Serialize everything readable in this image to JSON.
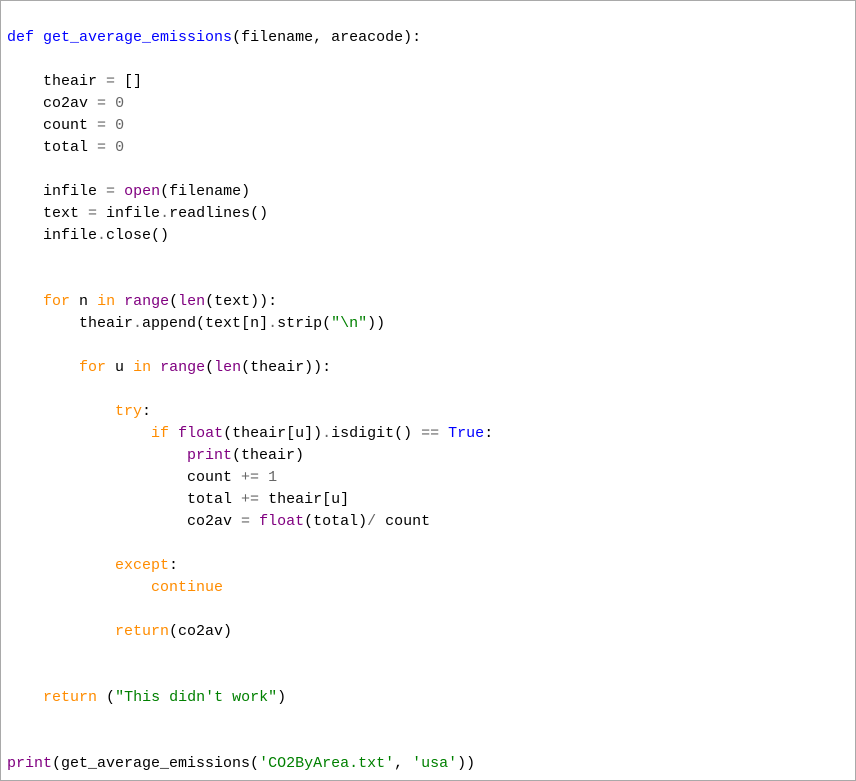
{
  "code": {
    "l1": {
      "def": "def",
      "fn": "get_average_emissions",
      "params": "(filename, areacode)",
      "colon": ":"
    },
    "l2": "",
    "l3": {
      "indent": "    ",
      "text1": "theair ",
      "op": "=",
      "text2": " []"
    },
    "l4": {
      "indent": "    ",
      "text1": "co2av ",
      "op": "=",
      "text2": " ",
      "num": "0"
    },
    "l5": {
      "indent": "    ",
      "text1": "count ",
      "op": "=",
      "text2": " ",
      "num": "0"
    },
    "l6": {
      "indent": "    ",
      "text1": "total ",
      "op": "=",
      "text2": " ",
      "num": "0"
    },
    "l7": "",
    "l8": {
      "indent": "    ",
      "text1": "infile ",
      "op": "=",
      "sp": " ",
      "builtin": "open",
      "text2": "(filename)"
    },
    "l9": {
      "indent": "    ",
      "text1": "text ",
      "op": "=",
      "text2": " infile",
      "dot": ".",
      "text3": "readlines()"
    },
    "l10": {
      "indent": "    ",
      "text1": "infile",
      "dot": ".",
      "text2": "close()"
    },
    "l11": "",
    "l12": "",
    "l13": {
      "indent": "    ",
      "for": "for",
      "sp1": " ",
      "var": "n",
      "sp2": " ",
      "in": "in",
      "sp3": " ",
      "range": "range",
      "lp": "(",
      "len": "len",
      "text": "(text))",
      "colon": ":"
    },
    "l14": {
      "indent": "        ",
      "text1": "theair",
      "dot": ".",
      "text2": "append(text[n]",
      "dot2": ".",
      "text3": "strip(",
      "str": "\"\\n\"",
      "text4": "))"
    },
    "l15": "",
    "l16": {
      "indent": "        ",
      "for": "for",
      "sp1": " ",
      "var": "u",
      "sp2": " ",
      "in": "in",
      "sp3": " ",
      "range": "range",
      "lp": "(",
      "len": "len",
      "text": "(theair))",
      "colon": ":"
    },
    "l17": "",
    "l18": {
      "indent": "            ",
      "try": "try",
      "colon": ":"
    },
    "l19": {
      "indent": "                ",
      "if": "if",
      "sp": " ",
      "float": "float",
      "text1": "(theair[u])",
      "dot": ".",
      "text2": "isdigit() ",
      "op": "==",
      "sp2": " ",
      "true": "True",
      "colon": ":"
    },
    "l20": {
      "indent": "                    ",
      "print": "print",
      "text": "(theair)"
    },
    "l21": {
      "indent": "                    ",
      "text1": "count ",
      "op": "+=",
      "text2": " ",
      "num": "1"
    },
    "l22": {
      "indent": "                    ",
      "text1": "total ",
      "op": "+=",
      "text2": " theair[u]"
    },
    "l23": {
      "indent": "                    ",
      "text1": "co2av ",
      "op": "=",
      "sp": " ",
      "float": "float",
      "text2": "(total)",
      "op2": "/",
      "text3": " count"
    },
    "l24": "",
    "l25": {
      "indent": "            ",
      "except": "except",
      "colon": ":"
    },
    "l26": {
      "indent": "                ",
      "continue": "continue"
    },
    "l27": "",
    "l28": {
      "indent": "            ",
      "return": "return",
      "text": "(co2av)"
    },
    "l29": "",
    "l30": "",
    "l31": {
      "indent": "    ",
      "return": "return",
      "sp": " ",
      "text1": "(",
      "str": "\"This didn't work\"",
      "text2": ")"
    },
    "l32": "",
    "l33": "",
    "l34": {
      "print": "print",
      "text1": "(get_average_emissions(",
      "str1": "'CO2ByArea.txt'",
      "comma": ", ",
      "str2": "'usa'",
      "text2": "))"
    }
  }
}
